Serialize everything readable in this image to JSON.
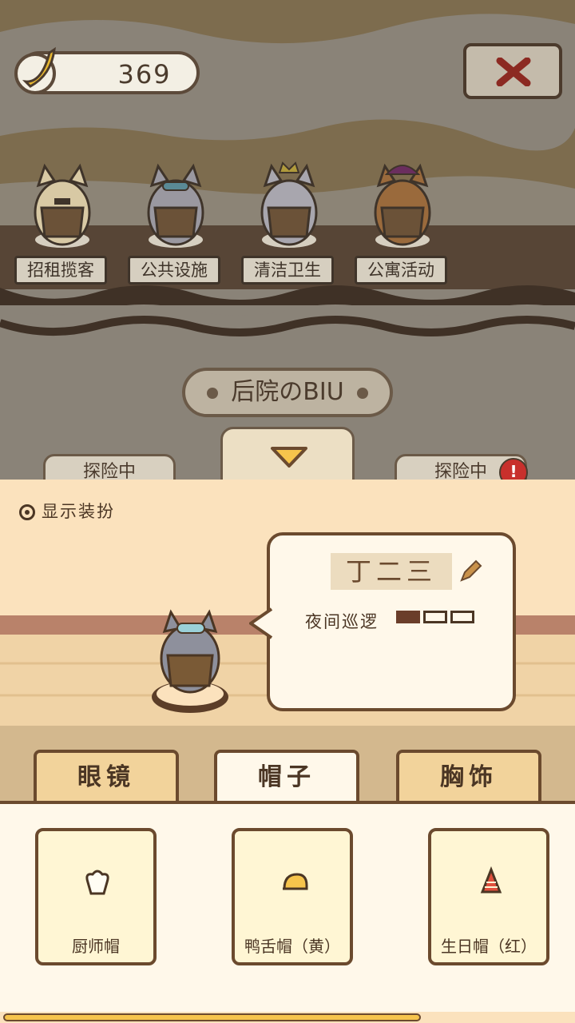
{
  "bananas": "369",
  "roles": [
    {
      "label": "招租揽客"
    },
    {
      "label": "公共设施"
    },
    {
      "label": "清洁卫生"
    },
    {
      "label": "公寓活动"
    }
  ],
  "area_title": "后院のBIU",
  "explore": {
    "left_label": "探险中",
    "right_label": "探险中"
  },
  "show_costume_label": "显示装扮",
  "cat_card": {
    "name": "丁二三",
    "skill": "夜间巡逻",
    "skill_level": 1,
    "skill_max": 3
  },
  "tabs": [
    {
      "label": "眼镜",
      "active": false
    },
    {
      "label": "帽子",
      "active": true
    },
    {
      "label": "胸饰",
      "active": false
    }
  ],
  "items": [
    {
      "name": "厨师帽",
      "icon": "chef-hat-icon"
    },
    {
      "name": "鸭舌帽（黄）",
      "icon": "yellow-cap-icon"
    },
    {
      "name": "生日帽（红）",
      "icon": "red-party-hat-icon"
    }
  ],
  "scroll_progress": 0.73,
  "colors": {
    "accent": "#f6c44c",
    "brown": "#6b4a2e",
    "alert": "#c8302c"
  }
}
